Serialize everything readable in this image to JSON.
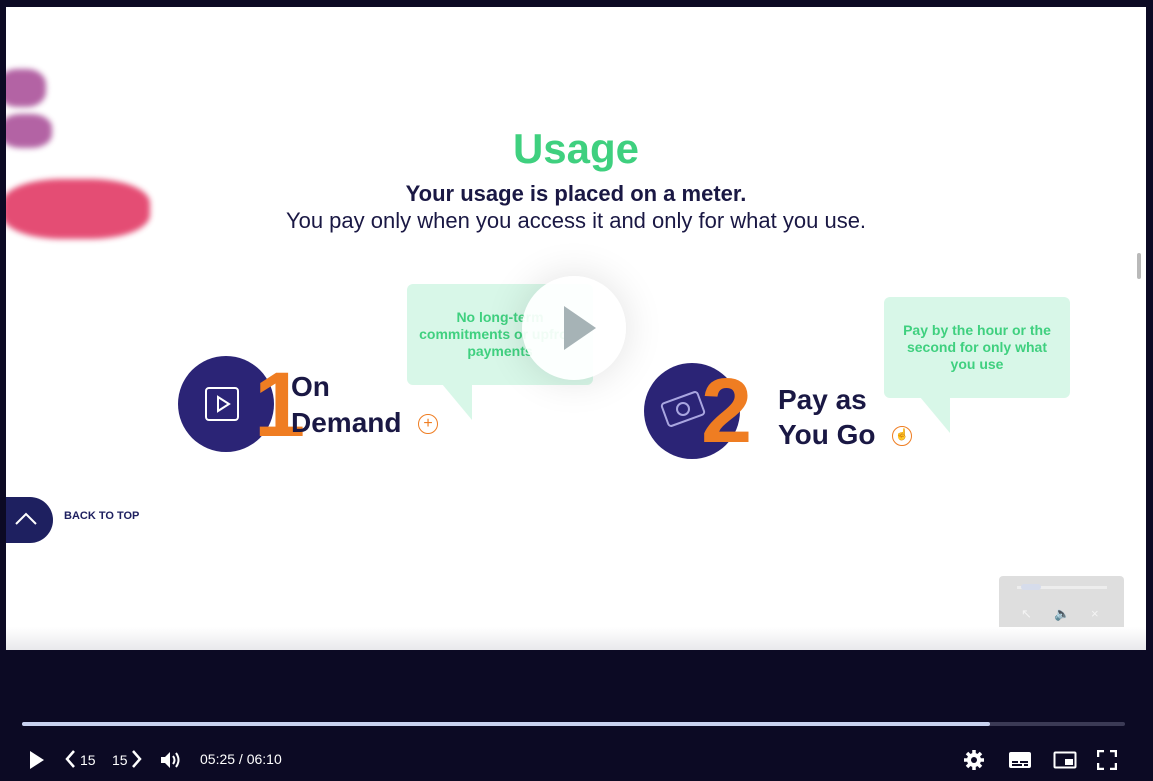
{
  "slide": {
    "title": "Usage",
    "subtitle_bold": "Your usage is placed on a meter.",
    "subtitle_regular": "You pay only when you access it and only for what you use.",
    "item1": {
      "number": "1",
      "label_line1": "On",
      "label_line2": "Demand",
      "bubble": "No long-term commitments or upfront payments"
    },
    "item2": {
      "number": "2",
      "label_line1": "Pay as",
      "label_line2": "You Go",
      "bubble": "Pay by the hour or the second for only what you use"
    },
    "back_to_top": "BACK TO TOP",
    "colors": {
      "accent_green": "#3fd07f",
      "navy": "#2b2476",
      "orange": "#ef7d22"
    }
  },
  "player": {
    "skip_back": "15",
    "skip_forward": "15",
    "current_time": "05:25",
    "separator": " / ",
    "duration": "06:10",
    "progress_fraction": 0.878
  }
}
